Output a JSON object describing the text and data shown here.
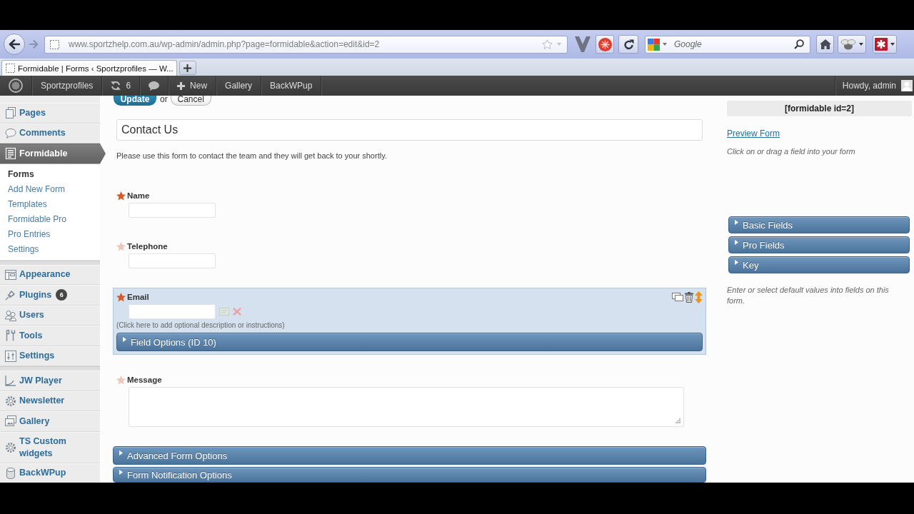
{
  "browser": {
    "url": "www.sportzhelp.com.au/wp-admin/admin.php?page=formidable&action=edit&id=2",
    "search": {
      "placeholder": "Google"
    },
    "tabs": [
      {
        "title": "Formidable | Forms ‹ Sportzprofiles — W...",
        "selected": true
      }
    ]
  },
  "admin_bar": {
    "items": [
      {
        "kind": "logo"
      },
      {
        "kind": "site",
        "label": "Sportzprofiles"
      },
      {
        "kind": "updates",
        "label": "6"
      },
      {
        "kind": "comments"
      },
      {
        "kind": "new",
        "label": "New"
      },
      {
        "kind": "link",
        "label": "Gallery"
      },
      {
        "kind": "link",
        "label": "BackWPup"
      }
    ],
    "account": "Howdy, admin"
  },
  "sidebar": {
    "groups": [
      {
        "items": [
          {
            "label": "Pages",
            "selected": false
          },
          {
            "label": "Comments",
            "selected": false
          },
          {
            "label": "Formidable",
            "selected": true,
            "children": [
              {
                "label": "Forms",
                "selected": true
              },
              {
                "label": "Add New Form",
                "selected": false
              },
              {
                "label": "Templates",
                "selected": false
              },
              {
                "label": "Formidable Pro",
                "selected": false
              },
              {
                "label": "Pro Entries",
                "selected": false
              },
              {
                "label": "Settings",
                "selected": false
              }
            ]
          }
        ]
      },
      {
        "items": [
          {
            "label": "Appearance",
            "selected": false
          },
          {
            "label": "Plugins",
            "selected": false,
            "badge": "6"
          },
          {
            "label": "Users",
            "selected": false
          },
          {
            "label": "Tools",
            "selected": false
          },
          {
            "label": "Settings",
            "selected": false
          }
        ]
      },
      {
        "items": [
          {
            "label": "JW Player",
            "selected": false
          },
          {
            "label": "Newsletter",
            "selected": false
          },
          {
            "label": "Gallery",
            "selected": false
          },
          {
            "label": "TS Custom widgets",
            "selected": false
          },
          {
            "label": "BackWPup",
            "selected": false
          }
        ]
      }
    ]
  },
  "form": {
    "buttons": {
      "update": "Update",
      "separator": "or",
      "cancel": "Cancel"
    },
    "title": "Contact Us",
    "description": "Please use this form to contact the team and they will get back to your shortly.",
    "fields": [
      {
        "kind": "text",
        "label": "Name",
        "required": true,
        "selected": false
      },
      {
        "kind": "text",
        "label": "Telephone",
        "required": false,
        "selected": false
      },
      {
        "kind": "text",
        "label": "Email",
        "required": true,
        "selected": true,
        "description": "(Click here to add optional description or instructions)",
        "options": {
          "label": "Field Options (ID 10)",
          "expanded": false
        }
      },
      {
        "kind": "textarea",
        "label": "Message",
        "required": false,
        "selected": false
      }
    ],
    "panels": [
      {
        "label": "Advanced Form Options",
        "expanded": false
      },
      {
        "label": "Form Notification Options",
        "expanded": false
      }
    ]
  },
  "side_panel": {
    "shortcode": "[formidable id=2]",
    "preview_link": "Preview Form",
    "instructions": "Click on or drag a field into your form",
    "sections": [
      {
        "label": "Basic Fields",
        "expanded": false
      },
      {
        "label": "Pro Fields",
        "expanded": false
      },
      {
        "label": "Key",
        "expanded": false
      }
    ],
    "note": "Enter or select default values into fields on this form."
  }
}
